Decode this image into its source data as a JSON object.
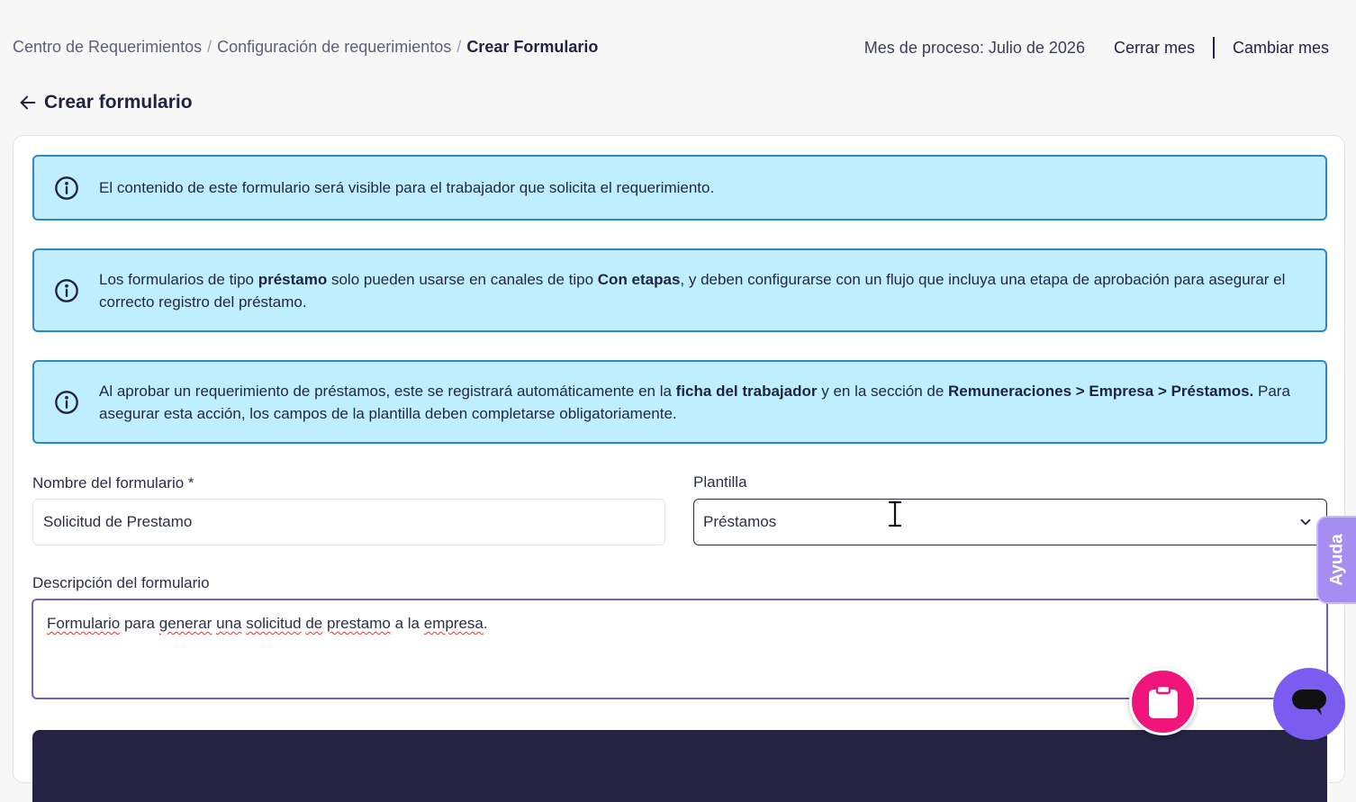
{
  "breadcrumb": {
    "item1": "Centro de Requerimientos",
    "item2": "Configuración de requerimientos",
    "current": "Crear Formulario",
    "separator": "/"
  },
  "header": {
    "process_month": "Mes de proceso: Julio de 2026",
    "close_month": "Cerrar mes",
    "change_month": "Cambiar mes"
  },
  "page": {
    "title": "Crear formulario"
  },
  "alerts": {
    "alert1": {
      "text": "El contenido de este formulario será visible para el trabajador que solicita el requerimiento."
    },
    "alert2": {
      "part1": "Los formularios de tipo ",
      "bold1": "préstamo",
      "part2": " solo pueden usarse en canales de tipo ",
      "bold2": "Con etapas",
      "part3": ", y deben configurarse con un flujo que incluya una etapa de aprobación para asegurar el correcto registro del préstamo."
    },
    "alert3": {
      "part1": "Al aprobar un requerimiento de préstamos, este se registrará automáticamente en la ",
      "bold1": "ficha del trabajador",
      "part2": " y en la sección de ",
      "bold2": "Remuneraciones > Empresa > Préstamos.",
      "part3": " Para asegurar esta acción, los campos de la plantilla deben completarse obligatoriamente."
    }
  },
  "form": {
    "name_label": "Nombre del formulario *",
    "name_value": "Solicitud de Prestamo",
    "template_label": "Plantilla",
    "template_value": "Préstamos",
    "description_label": "Descripción del formulario",
    "description": {
      "w1": "Formulario",
      "t1": " para ",
      "w2": "generar",
      "t2": " ",
      "w3": "una",
      "t3": " ",
      "w4": "solicitud",
      "t4": " ",
      "w5": "de",
      "t5": " ",
      "w6": "prestamo",
      "t6": " a la ",
      "w7": "empresa",
      "t7": "."
    }
  },
  "help": {
    "label": "Ayuda"
  },
  "colors": {
    "alert_bg": "#bfefff",
    "alert_border": "#2f86c8",
    "accent_purple": "#7c5cf0",
    "fab_pink": "#f0157a",
    "dark_bar": "#252342"
  },
  "icons": {
    "back": "arrow-left-icon",
    "info": "info-circle-icon",
    "chevron": "chevron-down-icon",
    "clipboard": "clipboard-icon",
    "chat": "chat-bubble-icon"
  }
}
